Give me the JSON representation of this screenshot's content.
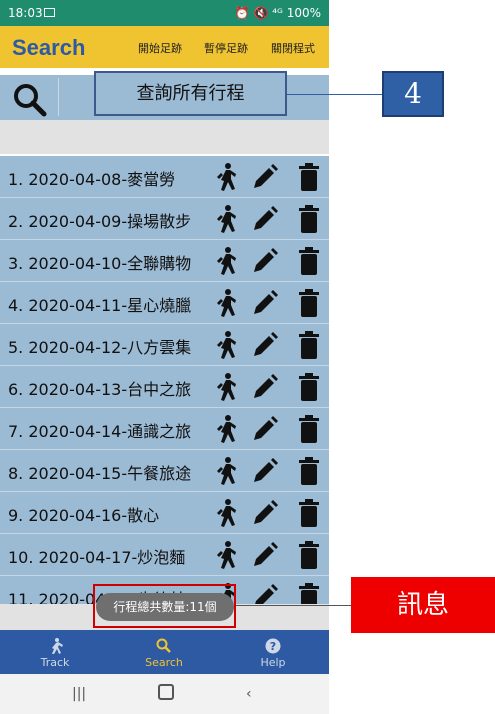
{
  "status": {
    "time": "18:03",
    "right": "⏰ 🔇 ⁴ᴳ 100%"
  },
  "appbar": {
    "title": "Search",
    "menu": [
      "開始足跡",
      "暫停足跡",
      "關閉程式"
    ]
  },
  "search": {
    "query_label": "查詢所有行程"
  },
  "trips": [
    "1. 2020-04-08-麥當勞",
    "2. 2020-04-09-操場散步",
    "3. 2020-04-10-全聯購物",
    "4. 2020-04-11-星心燒臘",
    "5. 2020-04-12-八方雲集",
    "6. 2020-04-13-台中之旅",
    "7. 2020-04-14-通識之旅",
    "8. 2020-04-15-午餐旅途",
    "9. 2020-04-16-散心",
    "10. 2020-04-17-炒泡麵",
    "11. 2020-04-18-肯德基"
  ],
  "toast": {
    "text": "行程總共數量:11個"
  },
  "nav": {
    "items": [
      "Track",
      "Search",
      "Help"
    ],
    "active": "Search"
  },
  "annotations": {
    "callout_number": "4",
    "callout_message": "訊息"
  },
  "colors": {
    "appbar": "#f0c430",
    "title": "#2d5aa3",
    "row": "#9bbad3",
    "bottom_nav": "#2d5aa3",
    "status": "#1f8c6e",
    "callout_red": "#ee0000"
  }
}
